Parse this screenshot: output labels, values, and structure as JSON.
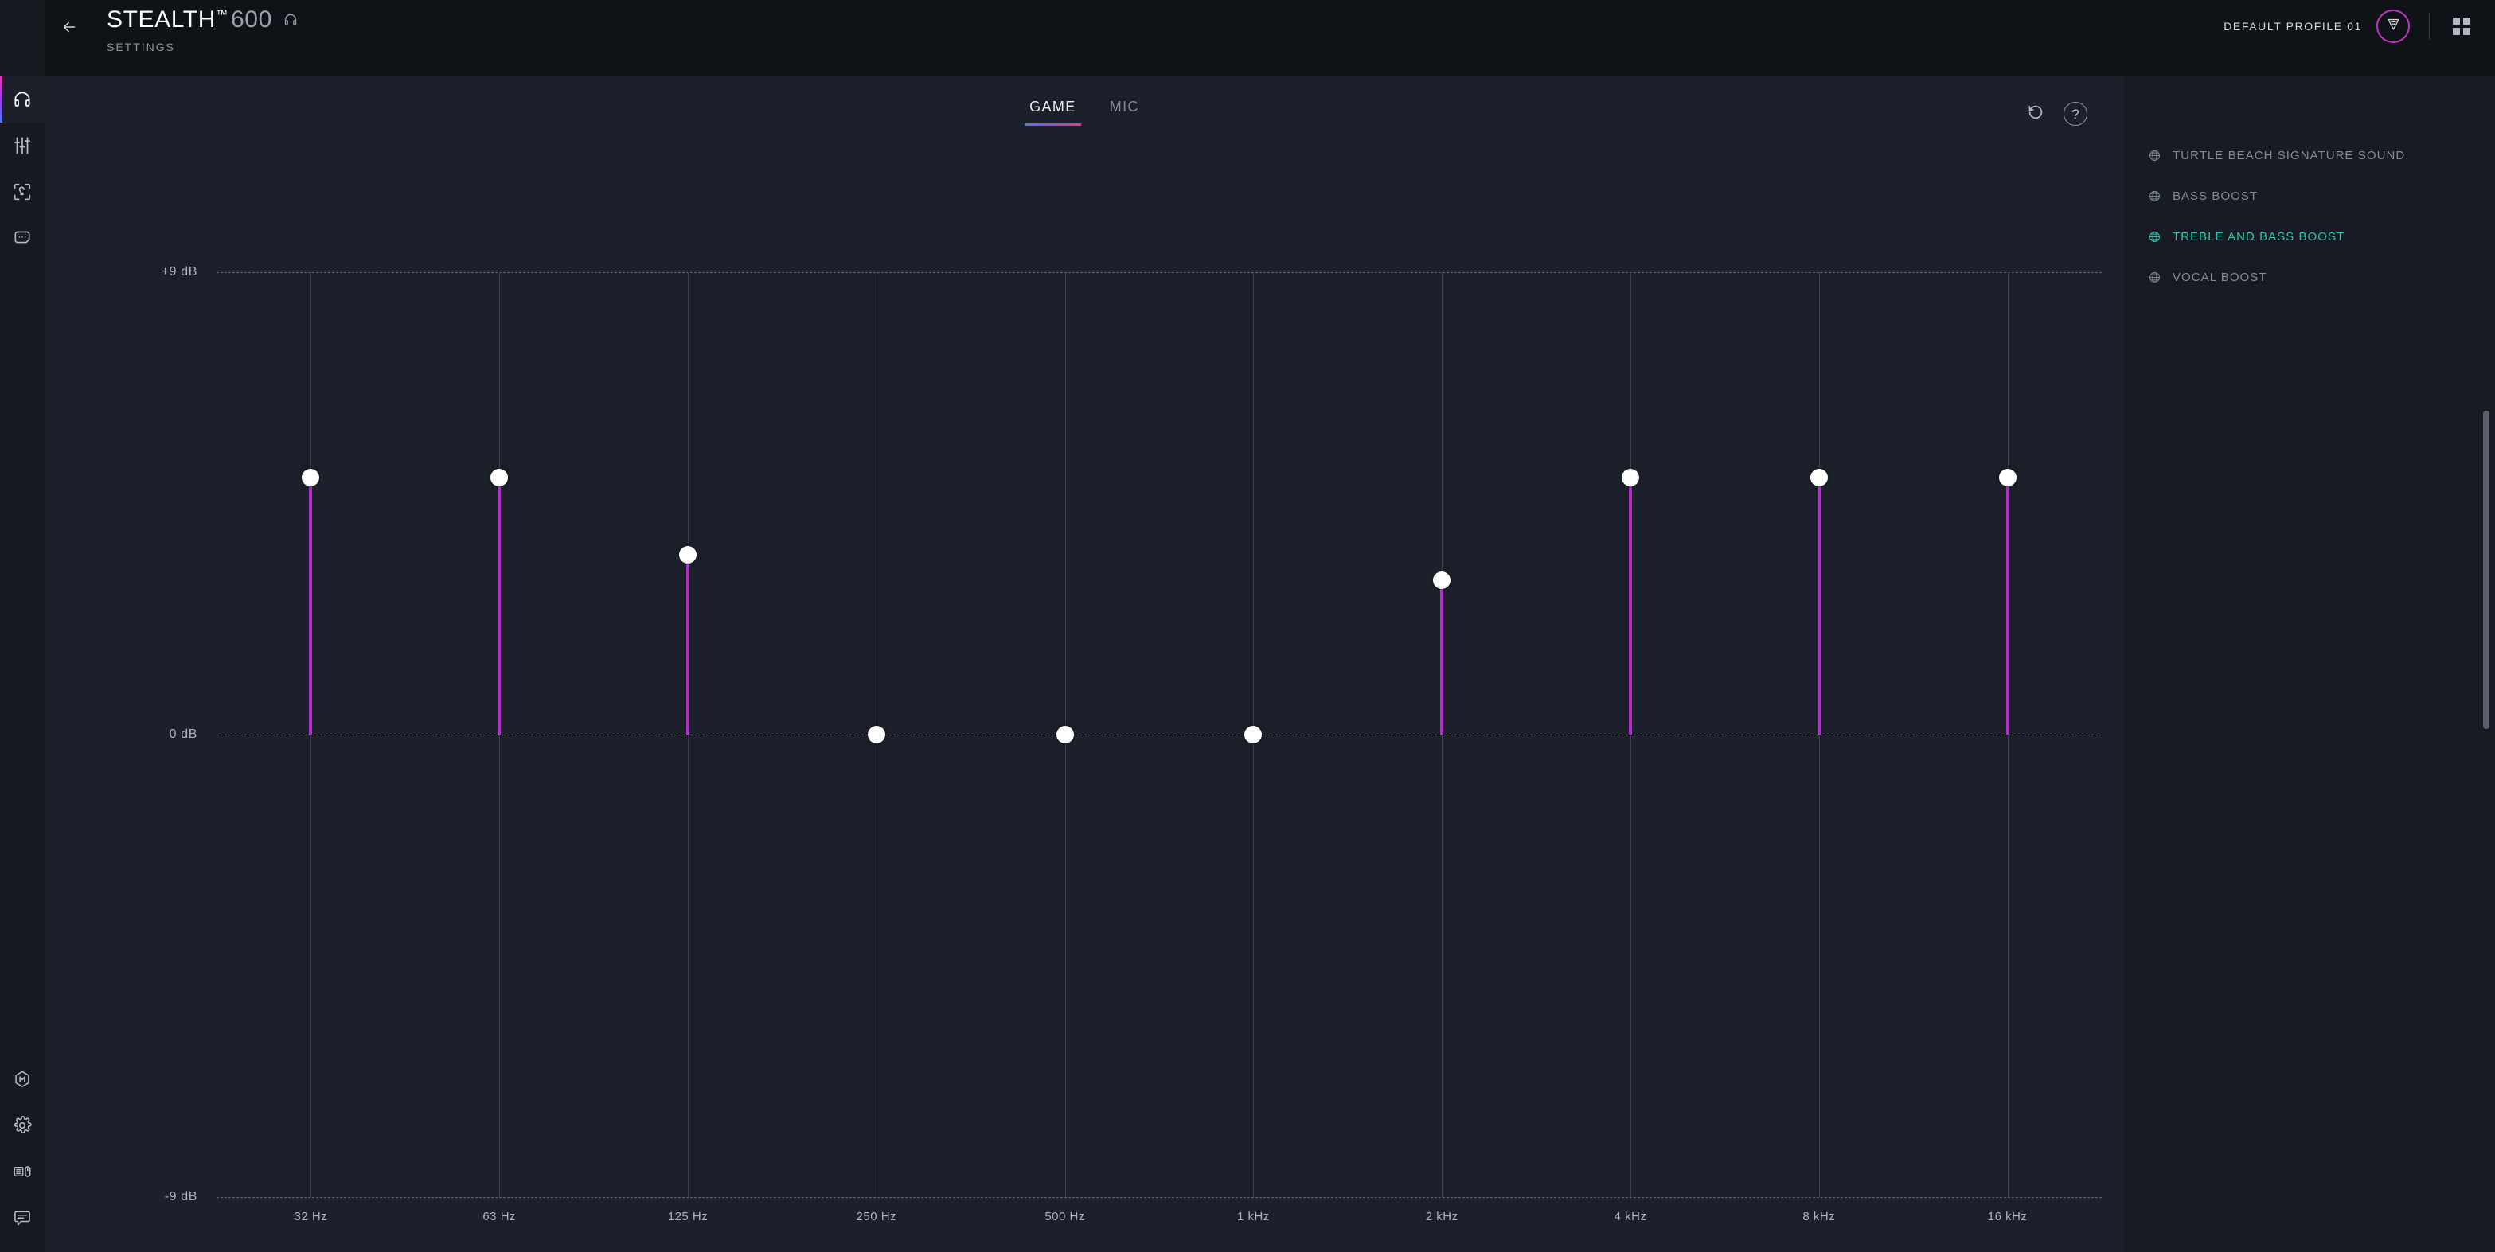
{
  "header": {
    "back_icon": "arrow-left-icon",
    "title_brand": "STEALTH",
    "title_tm": "™",
    "title_model": "600",
    "device_icon": "headset-icon",
    "subtitle": "SETTINGS",
    "profile_name": "DEFAULT PROFILE 01",
    "profile_badge_icon": "turtle-beach-logo-icon",
    "grid_icon": "apps-grid-icon"
  },
  "sidebar": {
    "top_items": [
      {
        "name": "headset",
        "icon": "headset-icon",
        "active": true
      },
      {
        "name": "audio-eq",
        "icon": "equalizer-sliders-icon",
        "active": false
      },
      {
        "name": "spatial-audio",
        "icon": "head-tracking-icon",
        "active": false
      },
      {
        "name": "chat-mix",
        "icon": "chat-bubble-icon",
        "active": false
      }
    ],
    "bottom_items": [
      {
        "name": "mixer",
        "icon": "hexagon-m-icon",
        "active": false
      },
      {
        "name": "settings",
        "icon": "gear-icon",
        "active": false
      },
      {
        "name": "devices",
        "icon": "keyboard-mouse-icon",
        "active": false
      },
      {
        "name": "feedback",
        "icon": "feedback-bubble-icon",
        "active": false
      }
    ]
  },
  "eq_panel": {
    "tabs": [
      {
        "label": "GAME",
        "active": true
      },
      {
        "label": "MIC",
        "active": false
      }
    ],
    "reset_icon": "reset-undo-icon",
    "help_icon": "question-mark-icon",
    "help_label": "?"
  },
  "presets": {
    "items": [
      {
        "label": "TURTLE BEACH SIGNATURE SOUND",
        "selected": false
      },
      {
        "label": "BASS BOOST",
        "selected": false
      },
      {
        "label": "TREBLE AND BASS BOOST",
        "selected": true
      },
      {
        "label": "VOCAL BOOST",
        "selected": false
      }
    ],
    "icon": "sphere-preset-icon",
    "selected_color": "#2fc4ab",
    "idle_color": "#838b97"
  },
  "chart_data": {
    "type": "bar",
    "title": "",
    "xlabel": "",
    "ylabel": "dB",
    "ylim": [
      -9,
      9
    ],
    "yticks": [
      9,
      0,
      -9
    ],
    "ytick_labels": [
      "+9 dB",
      "0 dB",
      "-9 dB"
    ],
    "grid": true,
    "categories": [
      "32 Hz",
      "63 Hz",
      "125 Hz",
      "250 Hz",
      "500 Hz",
      "1 kHz",
      "2 kHz",
      "4 kHz",
      "8 kHz",
      "16 kHz"
    ],
    "values": [
      5.0,
      5.0,
      3.5,
      0,
      0,
      0,
      3.0,
      5.0,
      5.0,
      5.0
    ],
    "bar_color": "#b32fc9",
    "knob_color": "#ffffff",
    "series": [
      {
        "name": "TREBLE AND BASS BOOST",
        "values": [
          5.0,
          5.0,
          3.5,
          0,
          0,
          0,
          3.0,
          5.0,
          5.0,
          5.0
        ]
      }
    ]
  }
}
